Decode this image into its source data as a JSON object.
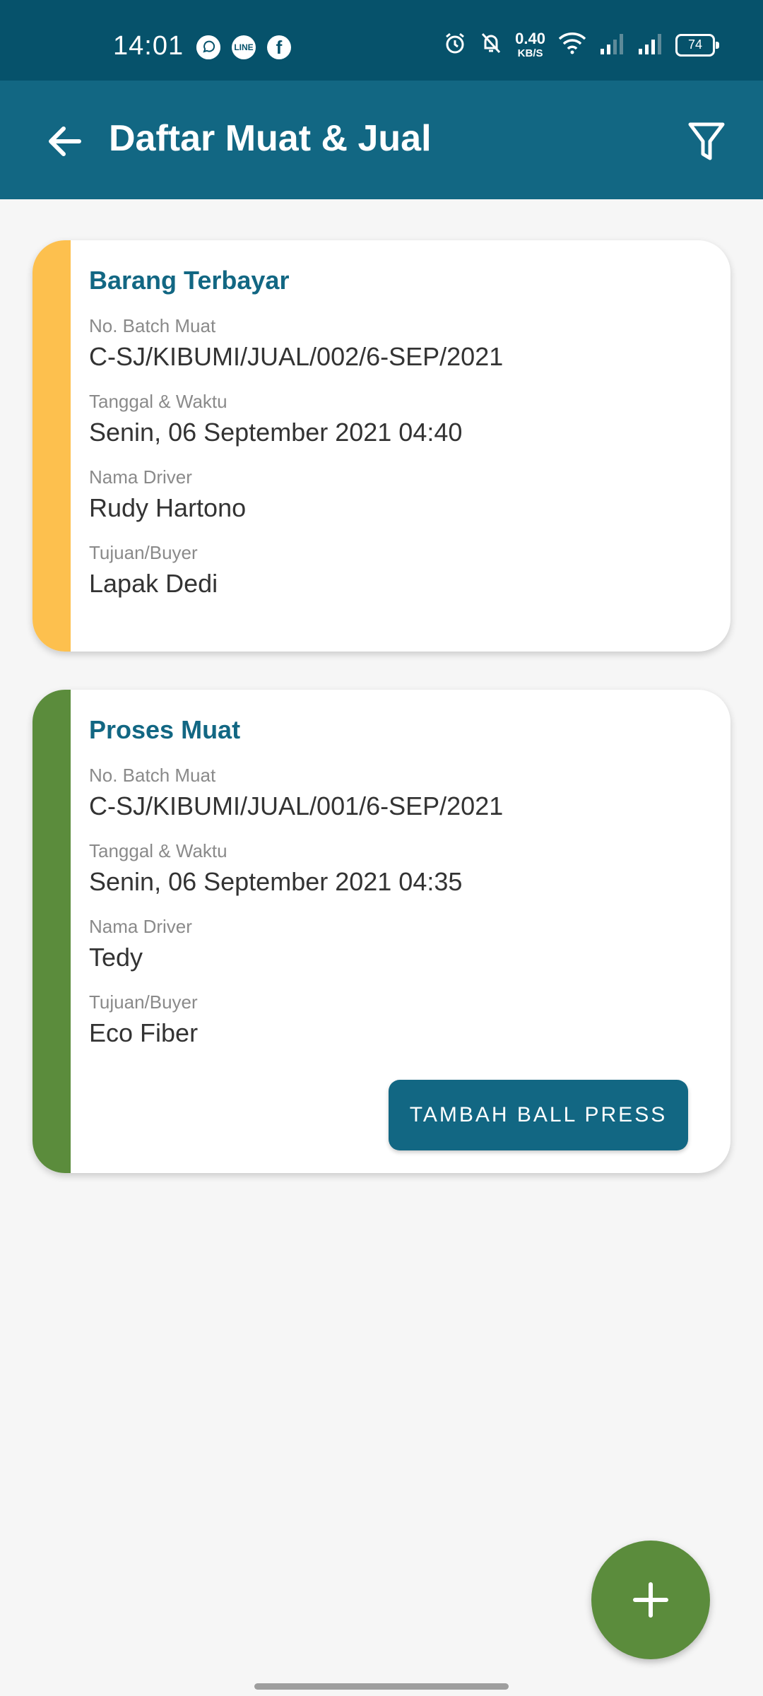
{
  "status_bar": {
    "time": "14:01",
    "app_icons": [
      "whatsapp-icon",
      "line-icon",
      "facebook-icon"
    ],
    "line_label": "LINE",
    "facebook_label": "f",
    "net_speed_value": "0.40",
    "net_speed_unit": "KB/S",
    "battery": "74"
  },
  "app_bar": {
    "title": "Daftar Muat & Jual",
    "back_icon": "arrow-left-icon",
    "filter_icon": "filter-icon"
  },
  "colors": {
    "status_bar": "#06526b",
    "app_bar": "#126783",
    "accent_text": "#126783",
    "stripe_paid": "#fdc04e",
    "stripe_process": "#5b8c3c",
    "fab": "#5b8c3c"
  },
  "cards": [
    {
      "status": "Barang Terbayar",
      "batch_label": "No. Batch Muat",
      "batch_value": "C-SJ/KIBUMI/JUAL/002/6-SEP/2021",
      "datetime_label": "Tanggal & Waktu",
      "datetime_value": "Senin, 06 September 2021 04:40",
      "driver_label": "Nama Driver",
      "driver_value": "Rudy Hartono",
      "buyer_label": "Tujuan/Buyer",
      "buyer_value": "Lapak Dedi"
    },
    {
      "status": "Proses Muat",
      "batch_label": "No. Batch Muat",
      "batch_value": "C-SJ/KIBUMI/JUAL/001/6-SEP/2021",
      "datetime_label": "Tanggal & Waktu",
      "datetime_value": "Senin, 06 September 2021 04:35",
      "driver_label": "Nama Driver",
      "driver_value": "Tedy",
      "buyer_label": "Tujuan/Buyer",
      "buyer_value": "Eco Fiber",
      "action_label": "TAMBAH BALL PRESS"
    }
  ],
  "fab": {
    "icon": "plus-icon"
  }
}
